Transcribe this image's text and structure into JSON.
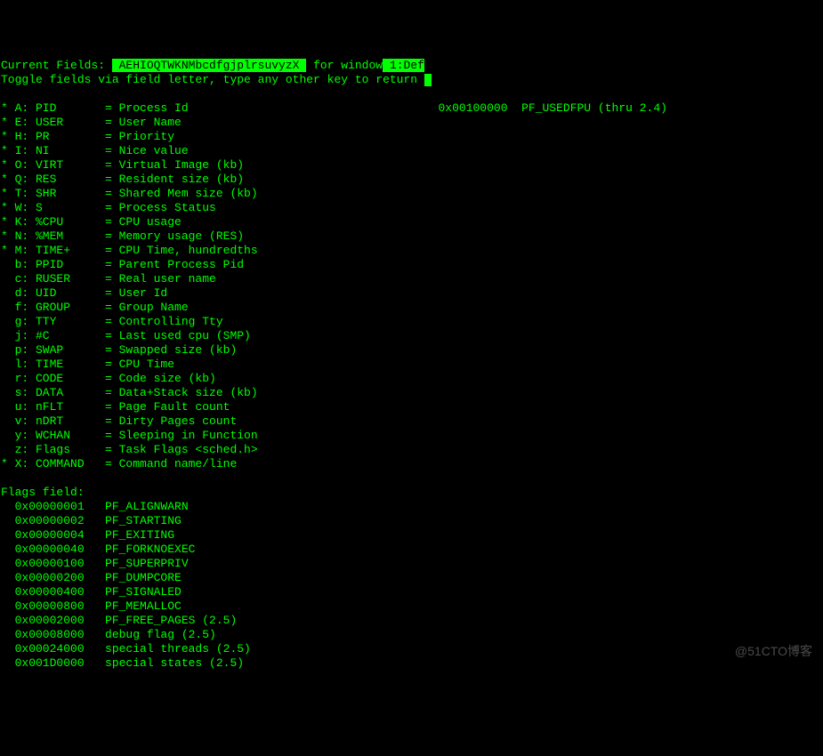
{
  "header": {
    "label_current_fields": "Current Fields:",
    "current_fields_value": " AEHIOQTWKNMbcdfgjplrsuvyzX ",
    "for_window_label": "for window",
    "window_value": " 1:Def",
    "toggle_instruction": "Toggle fields via field letter, type any other key to return "
  },
  "fields": [
    {
      "active": true,
      "letter": "A",
      "name": "PID",
      "desc": "Process Id"
    },
    {
      "active": true,
      "letter": "E",
      "name": "USER",
      "desc": "User Name"
    },
    {
      "active": true,
      "letter": "H",
      "name": "PR",
      "desc": "Priority"
    },
    {
      "active": true,
      "letter": "I",
      "name": "NI",
      "desc": "Nice value"
    },
    {
      "active": true,
      "letter": "O",
      "name": "VIRT",
      "desc": "Virtual Image (kb)"
    },
    {
      "active": true,
      "letter": "Q",
      "name": "RES",
      "desc": "Resident size (kb)"
    },
    {
      "active": true,
      "letter": "T",
      "name": "SHR",
      "desc": "Shared Mem size (kb)"
    },
    {
      "active": true,
      "letter": "W",
      "name": "S",
      "desc": "Process Status"
    },
    {
      "active": true,
      "letter": "K",
      "name": "%CPU",
      "desc": "CPU usage"
    },
    {
      "active": true,
      "letter": "N",
      "name": "%MEM",
      "desc": "Memory usage (RES)"
    },
    {
      "active": true,
      "letter": "M",
      "name": "TIME+",
      "desc": "CPU Time, hundredths"
    },
    {
      "active": false,
      "letter": "b",
      "name": "PPID",
      "desc": "Parent Process Pid"
    },
    {
      "active": false,
      "letter": "c",
      "name": "RUSER",
      "desc": "Real user name"
    },
    {
      "active": false,
      "letter": "d",
      "name": "UID",
      "desc": "User Id"
    },
    {
      "active": false,
      "letter": "f",
      "name": "GROUP",
      "desc": "Group Name"
    },
    {
      "active": false,
      "letter": "g",
      "name": "TTY",
      "desc": "Controlling Tty"
    },
    {
      "active": false,
      "letter": "j",
      "name": "#C",
      "desc": "Last used cpu (SMP)"
    },
    {
      "active": false,
      "letter": "p",
      "name": "SWAP",
      "desc": "Swapped size (kb)"
    },
    {
      "active": false,
      "letter": "l",
      "name": "TIME",
      "desc": "CPU Time"
    },
    {
      "active": false,
      "letter": "r",
      "name": "CODE",
      "desc": "Code size (kb)"
    },
    {
      "active": false,
      "letter": "s",
      "name": "DATA",
      "desc": "Data+Stack size (kb)"
    },
    {
      "active": false,
      "letter": "u",
      "name": "nFLT",
      "desc": "Page Fault count"
    },
    {
      "active": false,
      "letter": "v",
      "name": "nDRT",
      "desc": "Dirty Pages count"
    },
    {
      "active": false,
      "letter": "y",
      "name": "WCHAN",
      "desc": "Sleeping in Function"
    },
    {
      "active": false,
      "letter": "z",
      "name": "Flags",
      "desc": "Task Flags <sched.h>"
    },
    {
      "active": true,
      "letter": "X",
      "name": "COMMAND",
      "desc": "Command name/line"
    }
  ],
  "side_note": {
    "hex": "0x00100000",
    "label": "PF_USEDFPU (thru 2.4)"
  },
  "flags_header": "Flags field:",
  "flags": [
    {
      "hex": "0x00000001",
      "label": "PF_ALIGNWARN"
    },
    {
      "hex": "0x00000002",
      "label": "PF_STARTING"
    },
    {
      "hex": "0x00000004",
      "label": "PF_EXITING"
    },
    {
      "hex": "0x00000040",
      "label": "PF_FORKNOEXEC"
    },
    {
      "hex": "0x00000100",
      "label": "PF_SUPERPRIV"
    },
    {
      "hex": "0x00000200",
      "label": "PF_DUMPCORE"
    },
    {
      "hex": "0x00000400",
      "label": "PF_SIGNALED"
    },
    {
      "hex": "0x00000800",
      "label": "PF_MEMALLOC"
    },
    {
      "hex": "0x00002000",
      "label": "PF_FREE_PAGES (2.5)"
    },
    {
      "hex": "0x00008000",
      "label": "debug flag (2.5)"
    },
    {
      "hex": "0x00024000",
      "label": "special threads (2.5)"
    },
    {
      "hex": "0x001D0000",
      "label": "special states (2.5)"
    }
  ],
  "watermark": "@51CTO博客"
}
